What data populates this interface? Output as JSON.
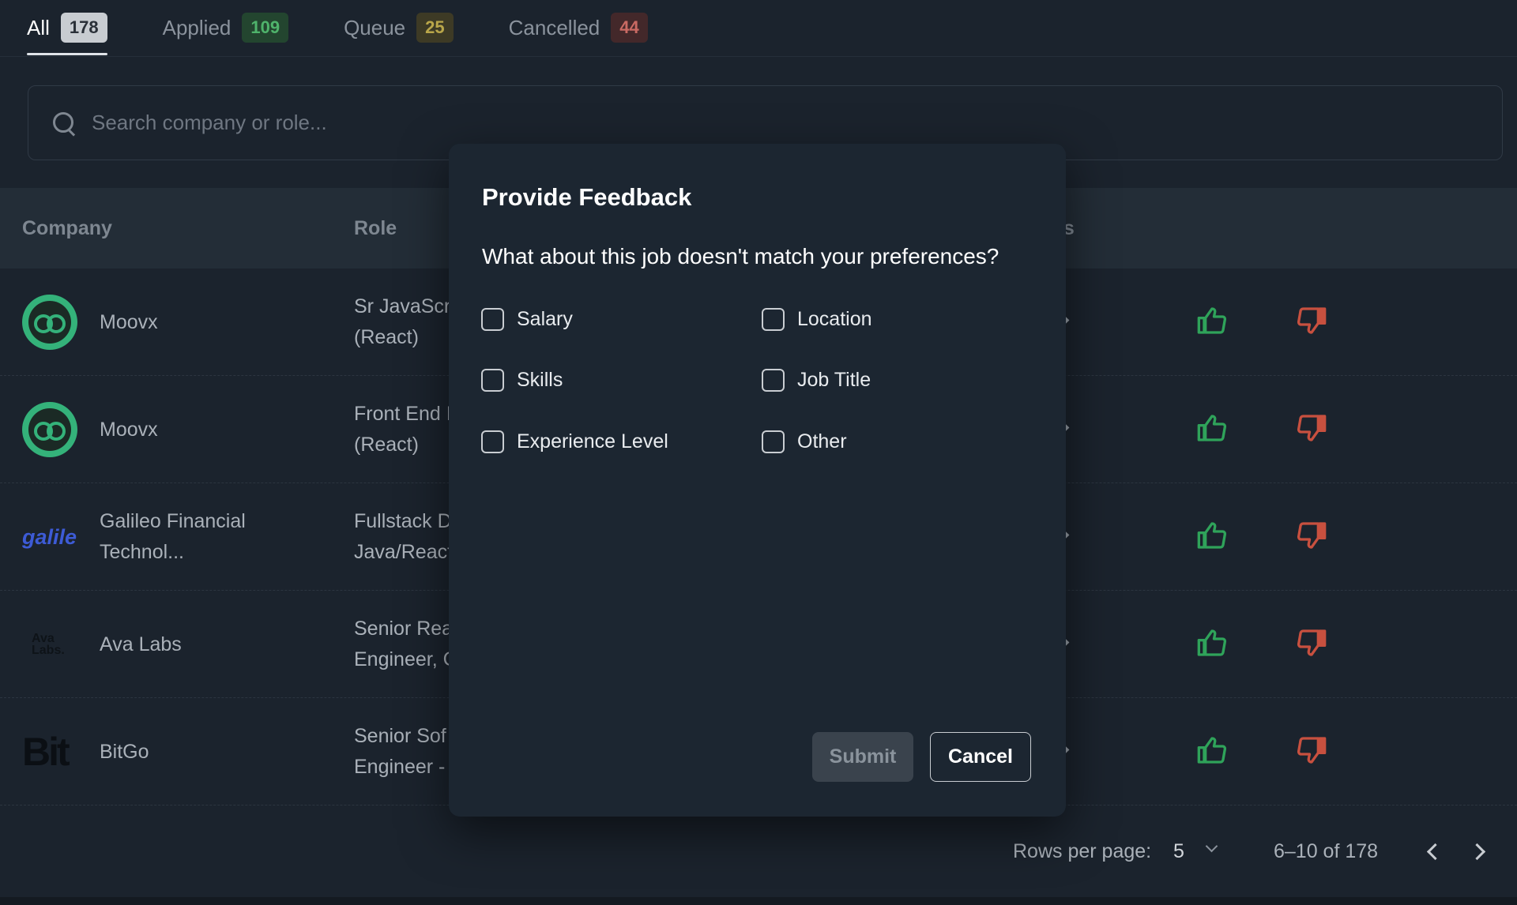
{
  "tabs": [
    {
      "label": "All",
      "count": "178"
    },
    {
      "label": "Applied",
      "count": "109"
    },
    {
      "label": "Queue",
      "count": "25"
    },
    {
      "label": "Cancelled",
      "count": "44"
    }
  ],
  "search": {
    "placeholder": "Search company or role..."
  },
  "table": {
    "headers": {
      "company": "Company",
      "role": "Role",
      "details": "ils"
    },
    "rows": [
      {
        "company": "Moovx",
        "company_line2": "",
        "role_line1": "Sr JavaScr",
        "role_line2": "(React)",
        "logo": "moovx-owl-logo"
      },
      {
        "company": "Moovx",
        "company_line2": "",
        "role_line1": "Front End I",
        "role_line2": "(React)",
        "logo": "moovx-owl-logo"
      },
      {
        "company": "Galileo Financial",
        "company_line2": "Technol...",
        "role_line1": "Fullstack D",
        "role_line2": "Java/React",
        "logo": "galileo-logo"
      },
      {
        "company": "Ava Labs",
        "company_line2": "",
        "role_line1": "Senior Rea",
        "role_line2": "Engineer, C",
        "logo": "ava-labs-logo"
      },
      {
        "company": "BitGo",
        "company_line2": "",
        "role_line1": "Senior Sof",
        "role_line2": "Engineer -",
        "logo": "bitgo-logo"
      }
    ],
    "logo_text": {
      "galileo": "galile",
      "ava_1": "Ava",
      "ava_2": "Labs.",
      "bit": "Bit"
    }
  },
  "footer": {
    "rows_per_page_label": "Rows per page:",
    "rows_per_page_value": "5",
    "range": "6–10 of 178"
  },
  "modal": {
    "title": "Provide Feedback",
    "question": "What about this job doesn't match your preferences?",
    "options": [
      "Salary",
      "Location",
      "Skills",
      "Job Title",
      "Experience Level",
      "Other"
    ],
    "submit_label": "Submit",
    "cancel_label": "Cancel"
  },
  "colors": {
    "thumb_up": "#2fa35a",
    "thumb_down": "#c8503f",
    "moovx_logo": "#34b27a"
  }
}
